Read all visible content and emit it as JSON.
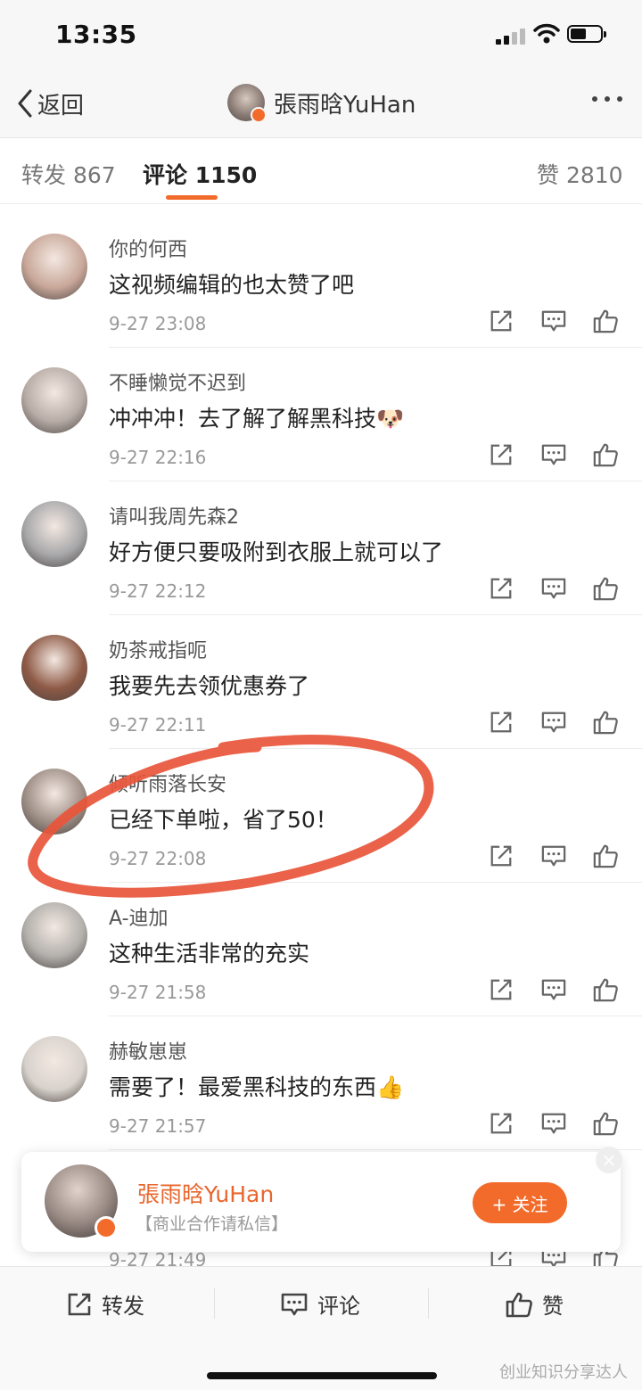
{
  "status": {
    "time": "13:35"
  },
  "nav": {
    "back_label": "返回",
    "title": "張雨晗YuHan"
  },
  "tabs": {
    "repost": {
      "label": "转发",
      "count": "867"
    },
    "comment": {
      "label": "评论",
      "count": "1150"
    },
    "like": {
      "label": "赞",
      "count": "2810"
    }
  },
  "comments": [
    {
      "author": "你的何西",
      "text": "这视频编辑的也太赞了吧",
      "date": "9-27 23:08",
      "avatar": "#c9a89a"
    },
    {
      "author": "不睡懒觉不迟到",
      "text": "冲冲冲！去了解了解黑科技🐶",
      "date": "9-27 22:16",
      "avatar": "#b7aca6"
    },
    {
      "author": "请叫我周先森2",
      "text": "好方便只要吸附到衣服上就可以了",
      "date": "9-27 22:12",
      "avatar": "#a8a8aa"
    },
    {
      "author": "奶茶戒指呃",
      "text": "我要先去领优惠券了",
      "date": "9-27 22:11",
      "avatar": "#8e5a46"
    },
    {
      "author": "倾听雨落长安",
      "text": "已经下单啦，省了50！",
      "date": "9-27 22:08",
      "avatar": "#9e8f86"
    },
    {
      "author": "A-迪加",
      "text": "这种生活非常的充实",
      "date": "9-27 21:58",
      "avatar": "#b3b0ac"
    },
    {
      "author": "赫敏崽崽",
      "text": "需要了！最爱黑科技的东西👍",
      "date": "9-27 21:57",
      "avatar": "#d8d2cc"
    },
    {
      "author": "",
      "text": "",
      "date": "9-27 21:49",
      "avatar": "#cccccc"
    }
  ],
  "popup": {
    "name": "張雨晗YuHan",
    "subtitle": "【商业合作请私信】",
    "follow_label": "+ 关注",
    "close_label": "×"
  },
  "bottom": {
    "repost_label": "转发",
    "comment_label": "评论",
    "like_label": "赞"
  },
  "watermark": "创业知识分享达人",
  "colors": {
    "accent": "#f26b2b",
    "annotation_circle": "#e8553a"
  }
}
